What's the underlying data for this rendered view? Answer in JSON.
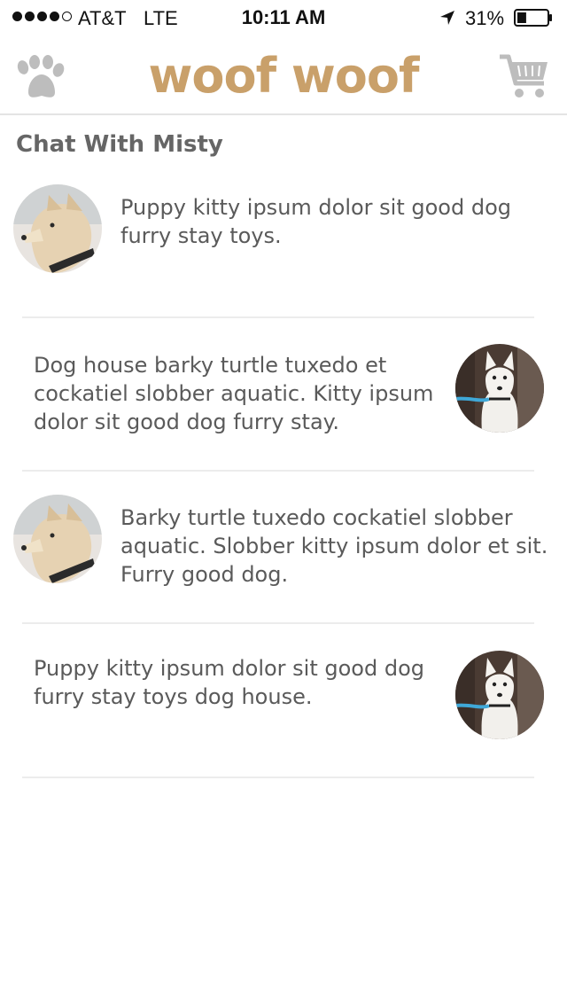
{
  "status_bar": {
    "carrier": "AT&T",
    "network": "LTE",
    "time": "10:11 AM",
    "battery_percent": "31%",
    "signal_bars_filled": 4,
    "signal_bars_total": 5,
    "battery_level": 0.31
  },
  "nav": {
    "logo_text": "woof woof",
    "left_icon": "paw-icon",
    "right_icon": "cart-icon",
    "brand_color": "#c9a06a",
    "icon_color": "#bdbdbd"
  },
  "chat": {
    "title": "Chat With Misty",
    "messages": [
      {
        "sender": "misty",
        "side": "left",
        "text": "Puppy kitty ipsum dolor sit good dog furry stay toys."
      },
      {
        "sender": "user",
        "side": "right",
        "text": "Dog house barky turtle tuxedo et cockatiel slobber aquatic. Kitty ipsum dolor sit good dog furry stay."
      },
      {
        "sender": "misty",
        "side": "left",
        "text": "Barky turtle tuxedo cockatiel slobber aquatic. Slobber kitty ipsum dolor et sit. Furry good dog."
      },
      {
        "sender": "user",
        "side": "right",
        "text": "Puppy kitty ipsum dolor sit good dog furry stay toys dog house."
      }
    ]
  }
}
